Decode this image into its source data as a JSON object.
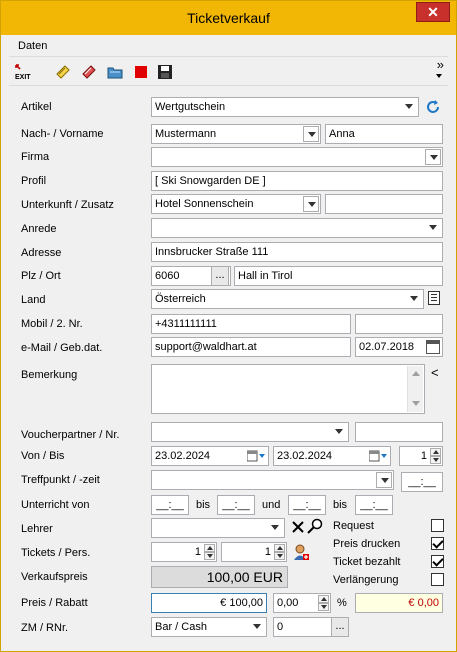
{
  "window": {
    "title": "Ticketverkauf",
    "close_glyph": "✕"
  },
  "menu": {
    "daten": "Daten"
  },
  "toolbar": {
    "exit_label": "EXIT",
    "overflow": "»"
  },
  "labels": {
    "artikel": "Artikel",
    "name": "Nach- / Vorname",
    "firma": "Firma",
    "profil": "Profil",
    "unterkunft": "Unterkunft / Zusatz",
    "anrede": "Anrede",
    "adresse": "Adresse",
    "plz": "Plz / Ort",
    "land": "Land",
    "mobil": "Mobil / 2. Nr.",
    "email": "e-Mail / Geb.dat.",
    "bemerkung": "Bemerkung",
    "voucher": "Voucherpartner / Nr.",
    "vonbis": "Von / Bis",
    "treffpunkt": "Treffpunkt / -zeit",
    "unterricht": "Unterricht von",
    "bis1": "bis",
    "und": "und",
    "bis2": "bis",
    "lehrer": "Lehrer",
    "tickets": "Tickets / Pers.",
    "verkaufspreis": "Verkaufspreis",
    "preis": "Preis / Rabatt",
    "percent": "%",
    "zm": "ZM / RNr.",
    "request": "Request",
    "preis_drucken": "Preis drucken",
    "ticket_bezahlt": "Ticket bezahlt",
    "verlaengerung": "Verlängerung"
  },
  "values": {
    "artikel": "Wertgutschein",
    "nachname": "Mustermann",
    "vorname": "Anna",
    "firma": "",
    "profil": "[ Ski Snowgarden DE ]",
    "unterkunft": "Hotel Sonnenschein",
    "zusatz": "",
    "anrede": "",
    "adresse": "Innsbrucker Straße 111",
    "plz": "6060",
    "ort": "Hall in Tirol",
    "land": "Österreich",
    "mobil": "+4311111111",
    "mobil2": "",
    "email": "support@waldhart.at",
    "gebdat": "02.07.2018",
    "bemerkung": "",
    "voucherpartner": "",
    "vouchernr": "",
    "von": "23.02.2024",
    "bis": "23.02.2024",
    "tage": "1",
    "treffpunkt": "",
    "treffzeit": "__:__",
    "unterricht_von1": "__:__",
    "unterricht_bis1": "__:__",
    "unterricht_von2": "__:__",
    "unterricht_bis2": "__:__",
    "lehrer": "",
    "tickets": "1",
    "personen": "1",
    "verkaufspreis": "100,00 EUR",
    "preis": "€ 100,00",
    "rabatt": "0,00",
    "rabatt_betrag": "€ 0,00",
    "zm": "Bar / Cash",
    "rnr": "0",
    "ellipsis": "...",
    "collapse": "<"
  },
  "checks": {
    "request": false,
    "preis_drucken": true,
    "ticket_bezahlt": true,
    "verlaengerung": false
  },
  "colors": {
    "titlebar": "#f2b705",
    "close": "#c7302b",
    "rabatt_bg": "#ffffe1",
    "rabatt_text": "#c00000"
  }
}
